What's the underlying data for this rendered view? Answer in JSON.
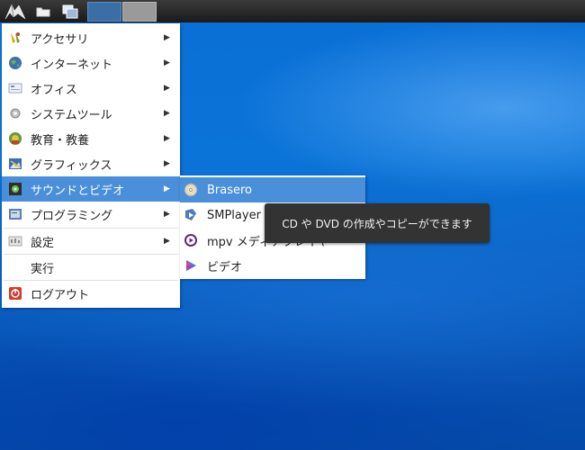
{
  "taskbar": {
    "start_icon": "lxde-start-icon",
    "folder_icon": "folder-icon",
    "desktop_icon": "show-desktop-icon"
  },
  "main_menu": {
    "items": [
      {
        "label": "アクセサリ",
        "icon": "accessories-icon",
        "has_submenu": true
      },
      {
        "label": "インターネット",
        "icon": "globe-icon",
        "has_submenu": true
      },
      {
        "label": "オフィス",
        "icon": "office-icon",
        "has_submenu": true
      },
      {
        "label": "システムツール",
        "icon": "system-tools-icon",
        "has_submenu": true
      },
      {
        "label": "教育・教養",
        "icon": "education-icon",
        "has_submenu": true
      },
      {
        "label": "グラフィックス",
        "icon": "graphics-icon",
        "has_submenu": true
      },
      {
        "label": "サウンドとビデオ",
        "icon": "multimedia-icon",
        "has_submenu": true,
        "active": true
      },
      {
        "label": "プログラミング",
        "icon": "programming-icon",
        "has_submenu": true
      },
      {
        "label": "設定",
        "icon": "settings-icon",
        "has_submenu": true
      },
      {
        "label": "実行",
        "icon": "",
        "has_submenu": false
      },
      {
        "label": "ログアウト",
        "icon": "logout-icon",
        "has_submenu": false
      }
    ]
  },
  "sub_menu": {
    "items": [
      {
        "label": "Brasero",
        "icon": "brasero-disc-icon",
        "active": true
      },
      {
        "label": "SMPlayer",
        "icon": "smplayer-icon"
      },
      {
        "label": "mpv メディアプレイヤー",
        "icon": "mpv-icon"
      },
      {
        "label": "ビデオ",
        "icon": "video-icon"
      }
    ]
  },
  "tooltip": {
    "text": "CD や DVD の作成やコピーができます"
  },
  "colors": {
    "highlight": "#4a8fd9",
    "panel": "#1a1a1a",
    "tooltip_bg": "#333333"
  }
}
